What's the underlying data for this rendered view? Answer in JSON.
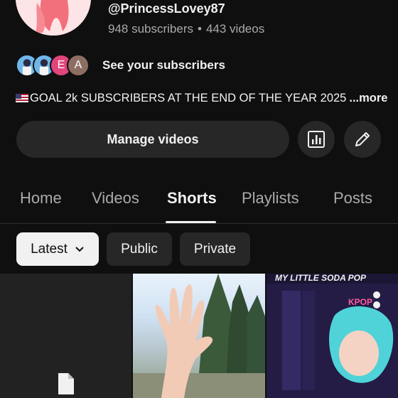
{
  "channel": {
    "handle": "@PrincessLovey87",
    "subscribers": "948 subscribers",
    "separator": "•",
    "videos": "443 videos",
    "subscriber_avatars": [
      {
        "type": "image",
        "icon": "subscriber-photo-1"
      },
      {
        "type": "image",
        "icon": "subscriber-photo-2"
      },
      {
        "type": "letter",
        "letter": "E",
        "color": "#e0457b"
      },
      {
        "type": "letter",
        "letter": "A",
        "color": "#8d6e63"
      }
    ],
    "see_subscribers": "See your subscribers",
    "description": "GOAL 2k SUBSCRIBERS AT THE END OF THE YEAR 2025",
    "description_flag": "us-flag-emoji",
    "more_label": "...more"
  },
  "actions": {
    "manage_videos": "Manage videos",
    "analytics_icon": "analytics-icon",
    "edit_icon": "pencil-icon"
  },
  "tabs": [
    {
      "label": "Home",
      "active": false
    },
    {
      "label": "Videos",
      "active": false
    },
    {
      "label": "Shorts",
      "active": true
    },
    {
      "label": "Playlists",
      "active": false
    },
    {
      "label": "Posts",
      "active": false
    }
  ],
  "filters": {
    "latest": "Latest",
    "public": "Public",
    "private": "Private"
  },
  "thumbnails": [
    {
      "kind": "placeholder",
      "icon": "file-icon"
    },
    {
      "kind": "photo",
      "description_icon": "hand-and-trees-image"
    },
    {
      "kind": "photo",
      "caption": "MY LITTLE SODA POP"
    }
  ],
  "colors": {
    "background": "#0f0f0f",
    "surface": "#272727",
    "text_primary": "#f1f1f1",
    "text_secondary": "#aaaaaa"
  }
}
